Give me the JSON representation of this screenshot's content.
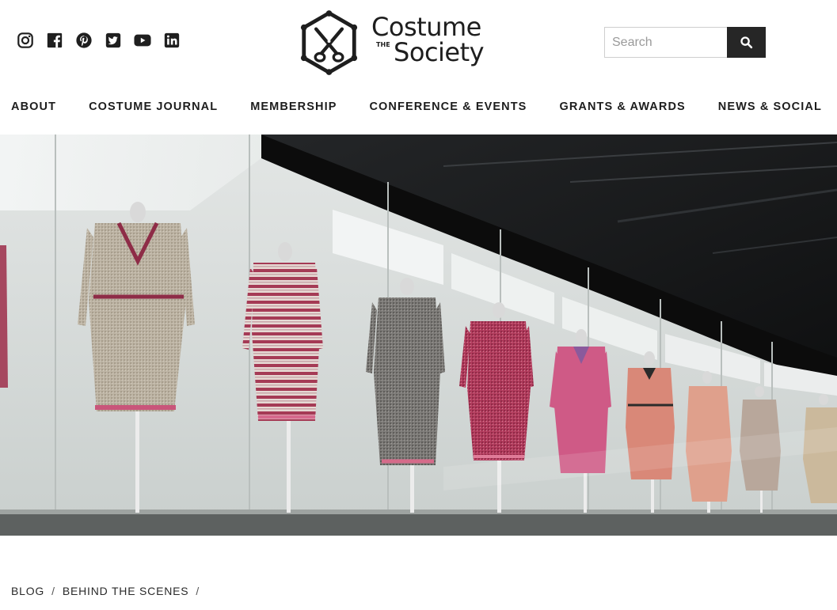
{
  "social": {
    "icons": [
      "instagram-icon",
      "facebook-icon",
      "pinterest-icon",
      "twitter-icon",
      "youtube-icon",
      "linkedin-icon"
    ]
  },
  "logo": {
    "line1": "Costume",
    "the": "THE",
    "line2": "Society"
  },
  "search": {
    "placeholder": "Search",
    "value": "",
    "button_icon": "search-icon"
  },
  "nav": {
    "items": [
      {
        "label": "ABOUT"
      },
      {
        "label": "COSTUME JOURNAL"
      },
      {
        "label": "MEMBERSHIP"
      },
      {
        "label": "CONFERENCE & EVENTS"
      },
      {
        "label": "GRANTS & AWARDS"
      },
      {
        "label": "NEWS & SOCIAL"
      }
    ]
  },
  "breadcrumb": {
    "items": [
      {
        "label": "BLOG"
      },
      {
        "label": "BEHIND THE SCENES"
      }
    ],
    "separator": "/"
  },
  "colors": {
    "text": "#1f1f1f",
    "search_button": "#262626",
    "hero_dark": "#141414",
    "hero_wall": "#d8dcdb"
  }
}
